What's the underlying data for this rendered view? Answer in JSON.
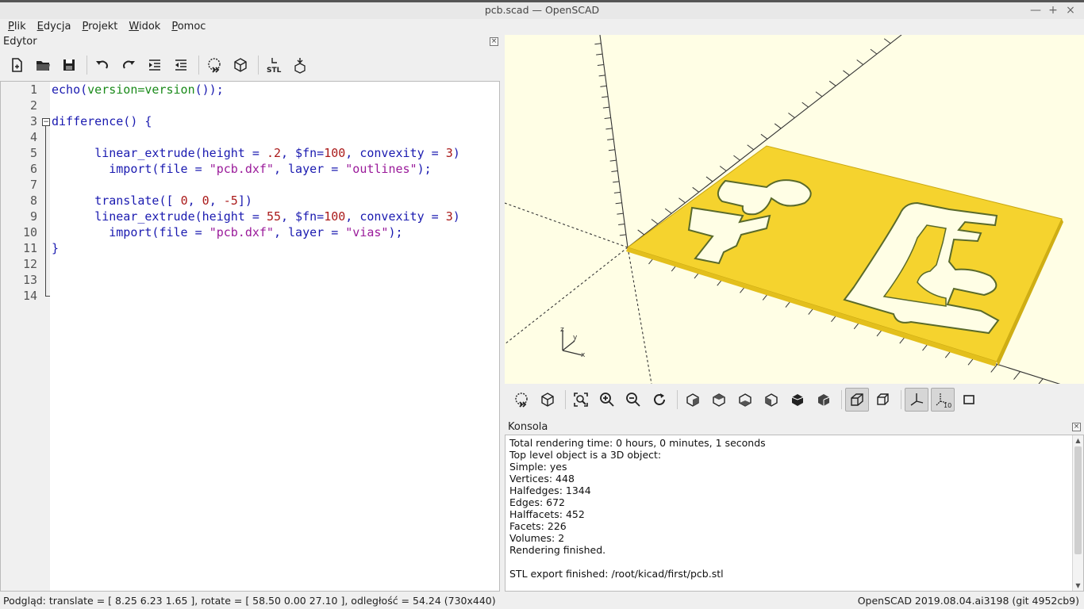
{
  "window": {
    "title": "pcb.scad — OpenSCAD",
    "buttons": {
      "minimize": "—",
      "maximize": "+",
      "close": "×"
    }
  },
  "menu": [
    "Plik",
    "Edycja",
    "Projekt",
    "Widok",
    "Pomoc"
  ],
  "editor": {
    "dock_title": "Edytor",
    "toolbar": [
      "new-file-icon",
      "open-file-icon",
      "save-icon",
      "undo-icon",
      "redo-icon",
      "indent-icon",
      "unindent-icon",
      "preview-icon",
      "render-icon",
      "export-stl-icon",
      "send-to-print-icon"
    ],
    "stl_label": "STL",
    "line_numbers": [
      "1",
      "2",
      "3",
      "4",
      "5",
      "6",
      "7",
      "8",
      "9",
      "10",
      "11",
      "12",
      "13",
      "14"
    ],
    "lines": [
      [
        [
          "kw",
          "echo("
        ],
        [
          "fn",
          "version=version"
        ],
        [
          "kw",
          "());"
        ]
      ],
      [],
      [
        [
          "kw",
          "difference() {"
        ]
      ],
      [],
      [
        [
          "plain",
          "      "
        ],
        [
          "kw",
          "linear_extrude(height = "
        ],
        [
          "num",
          ".2"
        ],
        [
          "kw",
          ", $fn="
        ],
        [
          "num",
          "100"
        ],
        [
          "kw",
          ", convexity = "
        ],
        [
          "num",
          "3"
        ],
        [
          "kw",
          ")"
        ]
      ],
      [
        [
          "plain",
          "        "
        ],
        [
          "kw",
          "import(file = "
        ],
        [
          "str",
          "\"pcb.dxf\""
        ],
        [
          "kw",
          ", layer = "
        ],
        [
          "str",
          "\"outlines\""
        ],
        [
          "kw",
          ");"
        ]
      ],
      [],
      [
        [
          "plain",
          "      "
        ],
        [
          "kw",
          "translate([ "
        ],
        [
          "num",
          "0"
        ],
        [
          "kw",
          ", "
        ],
        [
          "num",
          "0"
        ],
        [
          "kw",
          ", "
        ],
        [
          "num",
          "-5"
        ],
        [
          "kw",
          "])"
        ]
      ],
      [
        [
          "plain",
          "      "
        ],
        [
          "kw",
          "linear_extrude(height = "
        ],
        [
          "num",
          "55"
        ],
        [
          "kw",
          ", $fn="
        ],
        [
          "num",
          "100"
        ],
        [
          "kw",
          ", convexity = "
        ],
        [
          "num",
          "3"
        ],
        [
          "kw",
          ")"
        ]
      ],
      [
        [
          "plain",
          "        "
        ],
        [
          "kw",
          "import(file = "
        ],
        [
          "str",
          "\"pcb.dxf\""
        ],
        [
          "kw",
          ", layer = "
        ],
        [
          "str",
          "\"vias\""
        ],
        [
          "kw",
          ");"
        ]
      ],
      [
        [
          "kw",
          "}"
        ]
      ],
      [],
      [],
      []
    ]
  },
  "viewport": {
    "background": "#fffee5",
    "model_color": "#f5d32e",
    "axis_labels": {
      "x": "x",
      "y": "y",
      "z": "z"
    }
  },
  "view_toolbar": [
    "preview-icon",
    "render-icon",
    "view-all-icon",
    "zoom-in-icon",
    "zoom-out-icon",
    "reset-view-icon",
    "view-right-icon",
    "view-top-icon",
    "view-bottom-icon",
    "view-left-icon",
    "view-front-icon",
    "view-back-icon",
    "perspective-icon",
    "orthogonal-icon",
    "show-axes-icon",
    "show-scale-icon",
    "show-edges-icon"
  ],
  "view_toolbar_scale_label": "10",
  "console": {
    "dock_title": "Konsola",
    "lines": [
      "Total rendering time: 0 hours, 0 minutes, 1 seconds",
      "Top level object is a 3D object:",
      "Simple:     yes",
      "Vertices:     448",
      "Halfedges:    1344",
      "Edges:        672",
      "Halffacets:   452",
      "Facets:       226",
      "Volumes:        2",
      "Rendering finished.",
      "",
      "STL export finished: /root/kicad/first/pcb.stl"
    ]
  },
  "status": {
    "left": "Podgląd: translate = [ 8.25 6.23 1.65 ], rotate = [ 58.50 0.00 27.10 ], odległość = 54.24 (730x440)",
    "right": "OpenSCAD 2019.08.04.ai3198 (git 4952cb9)"
  }
}
